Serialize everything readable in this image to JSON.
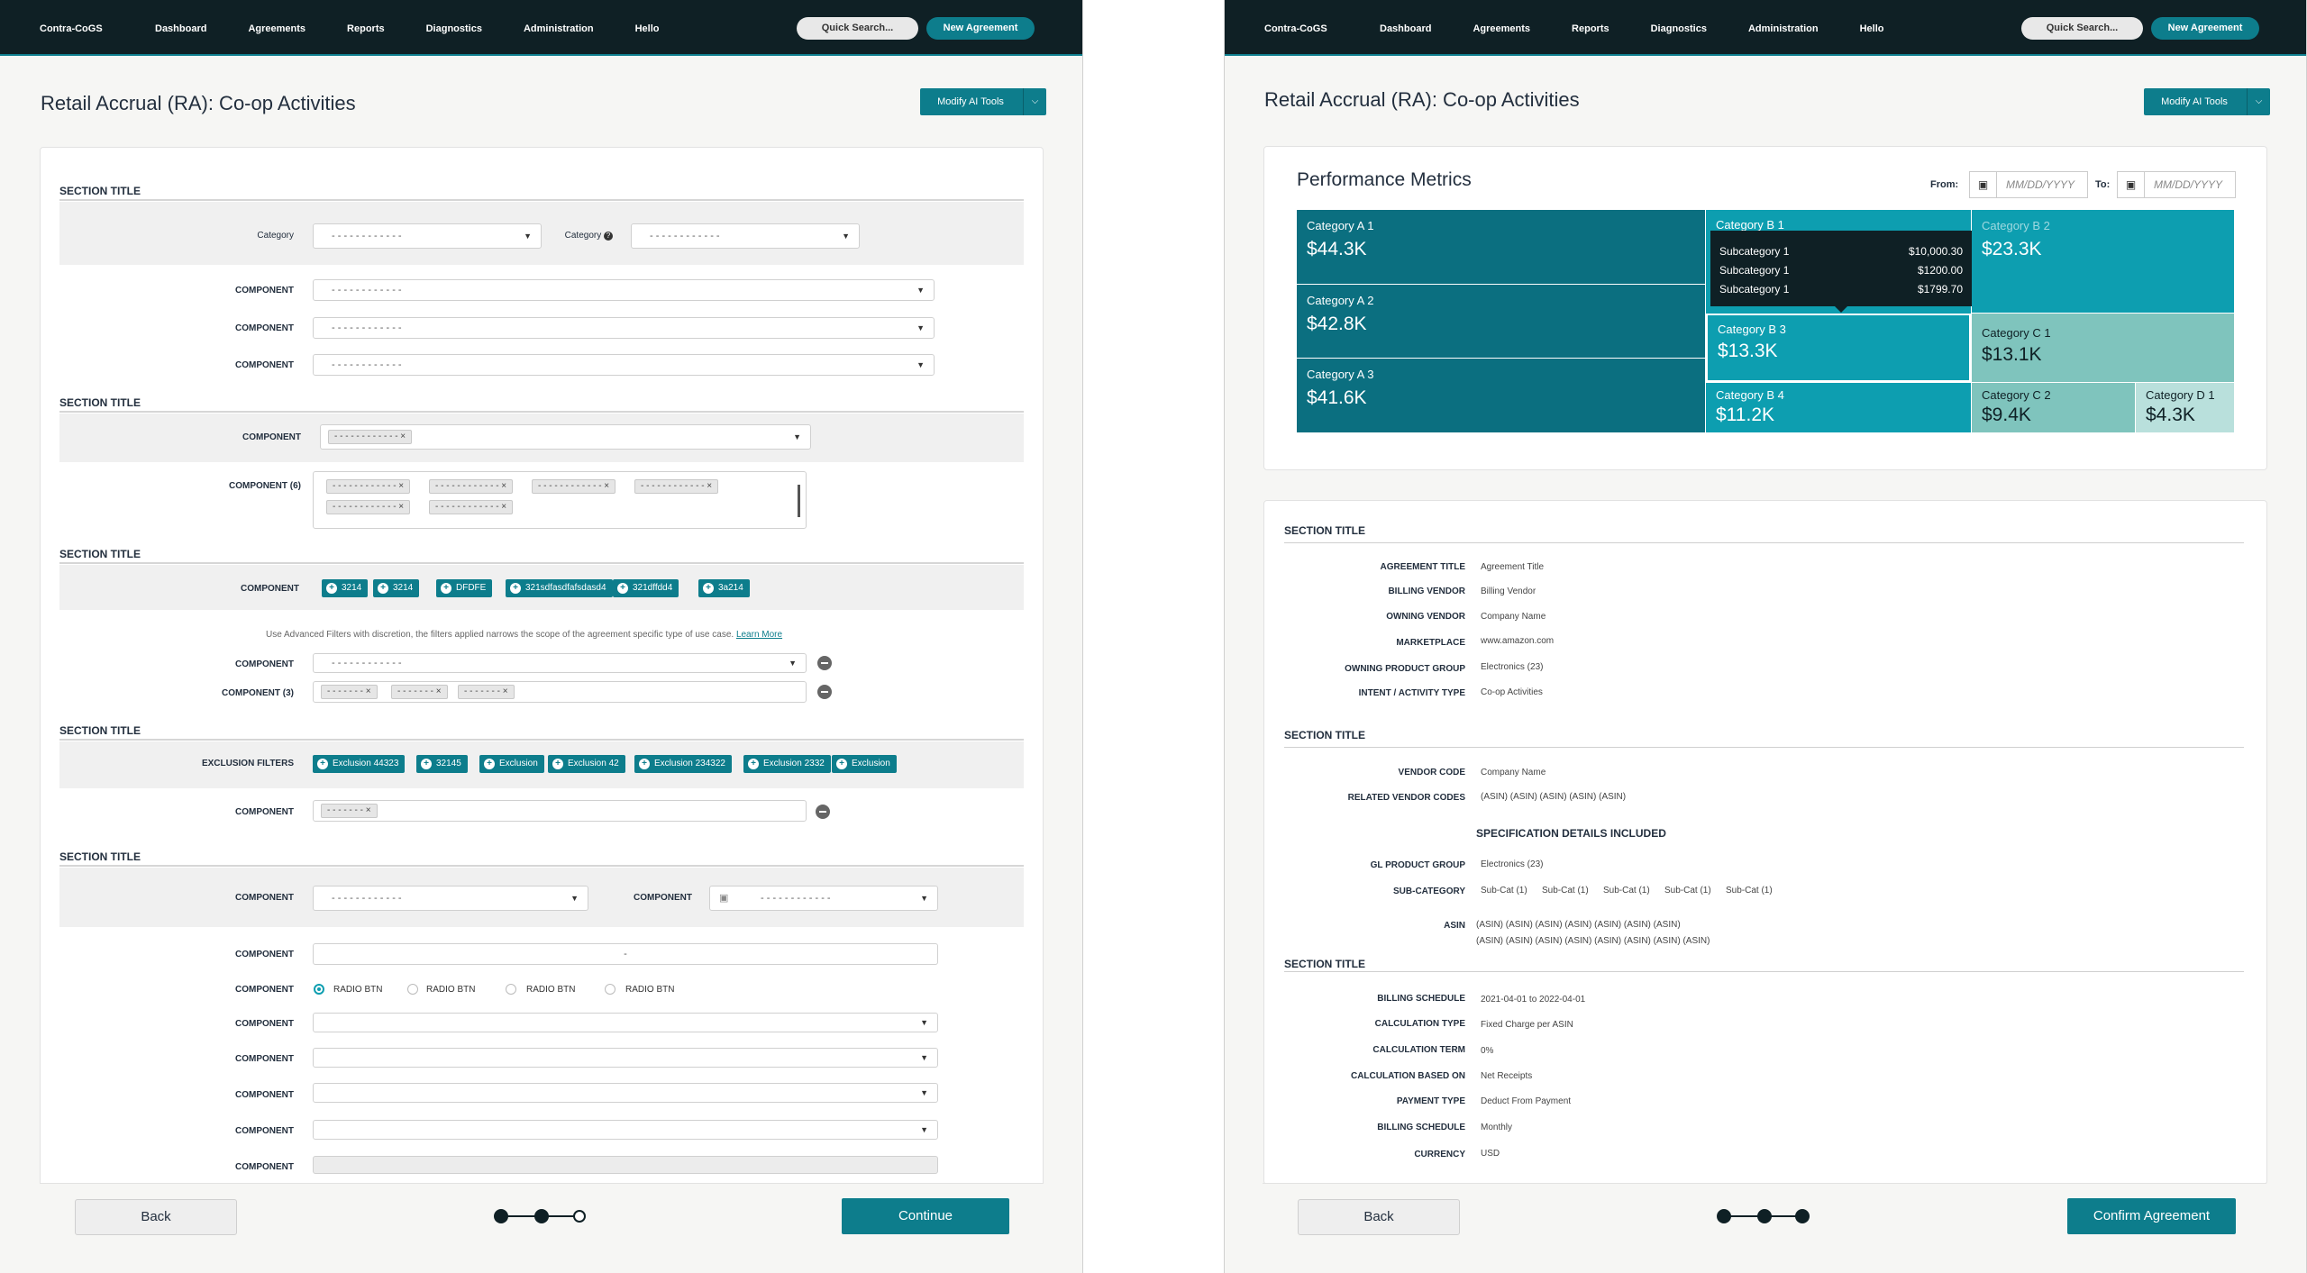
{
  "nav": {
    "brand": "Contra-CoGS",
    "links": [
      "Dashboard",
      "Agreements",
      "Reports",
      "Diagnostics",
      "Administration",
      "Hello"
    ],
    "search_placeholder": "Quick Search...",
    "new_agreement": "New Agreement"
  },
  "page_title": "Retail Accrual (RA): Co-op Activities",
  "modify_tools": "Modify AI Tools",
  "left": {
    "section_title": "SECTION TITLE",
    "category_label": "Category",
    "placeholder": "- - - - - - - - - - - -",
    "short_placeholder": "- - - - - - -",
    "comp_label": "COMPONENT",
    "comp6_label": "COMPONENT (6)",
    "comp3_label": "COMPONENT (3)",
    "excl_label": "EXCLUSION FILTERS",
    "chips_a": [
      "3214",
      "3214",
      "DFDFE",
      "321sdfasdfafsdasd4",
      "321dffdd4",
      "3a214"
    ],
    "chips_excl": [
      "Exclusion 44323",
      "32145",
      "Exclusion",
      "Exclusion 42",
      "Exclusion 234322",
      "Exclusion 2332",
      "Exclusion"
    ],
    "hint_text": "Use Advanced Filters with discretion, the filters applied narrows the scope of the agreement specific type of use case.",
    "learn_more": "Learn More",
    "radio_label": "RADIO BTN",
    "dot_value": "-"
  },
  "perf": {
    "title": "Performance Metrics",
    "from": "From:",
    "to": "To:",
    "date_placeholder": "MM/DD/YYYY"
  },
  "chart_data": {
    "type": "treemap",
    "title": "Performance Metrics",
    "nodes": [
      {
        "name": "Category A 1",
        "value": "$44.3K"
      },
      {
        "name": "Category A 2",
        "value": "$42.8K"
      },
      {
        "name": "Category A 3",
        "value": "$41.6K"
      },
      {
        "name": "Category B 1",
        "value": ""
      },
      {
        "name": "Category B 2",
        "value": "$23.3K"
      },
      {
        "name": "Category B 3",
        "value": "$13.3K"
      },
      {
        "name": "Category B 4",
        "value": "$11.2K"
      },
      {
        "name": "Category C 1",
        "value": "$13.1K"
      },
      {
        "name": "Category C 2",
        "value": "$9.4K"
      },
      {
        "name": "Category D 1",
        "value": "$4.3K"
      }
    ],
    "tooltip": [
      {
        "label": "Subcategory 1",
        "value": "$10,000.30"
      },
      {
        "label": "Subcategory 1",
        "value": "$1200.00"
      },
      {
        "label": "Subcategory 1",
        "value": "$1799.70"
      }
    ],
    "colors": {
      "A": "#0b6f80",
      "B": "#0d9eb0",
      "C": "#7fc4bd",
      "D": "#b9e0dc"
    }
  },
  "summary": {
    "section_title": "SECTION TITLE",
    "group1": [
      {
        "label": "AGREEMENT TITLE",
        "value": "Agreement Title"
      },
      {
        "label": "BILLING VENDOR",
        "value": "Billing Vendor"
      },
      {
        "label": "OWNING VENDOR",
        "value": "Company Name"
      },
      {
        "label": "MARKETPLACE",
        "value": "www.amazon.com"
      },
      {
        "label": "OWNING PRODUCT GROUP",
        "value": "Electronics (23)"
      },
      {
        "label": "INTENT / ACTIVITY TYPE",
        "value": "Co-op Activities"
      }
    ],
    "group2": [
      {
        "label": "VENDOR CODE",
        "value": "Company Name"
      },
      {
        "label": "RELATED VENDOR CODES",
        "value": "(ASIN) (ASIN) (ASIN) (ASIN) (ASIN)"
      }
    ],
    "spec_title": "SPECIFICATION DETAILS INCLUDED",
    "gl_label": "GL PRODUCT GROUP",
    "gl_value": "Electronics (23)",
    "subcat_label": "SUB-CATEGORY",
    "subcats": [
      "Sub-Cat (1)",
      "Sub-Cat (1)",
      "Sub-Cat (1)",
      "Sub-Cat (1)",
      "Sub-Cat (1)"
    ],
    "asin_label": "ASIN",
    "asin_line1": "(ASIN) (ASIN) (ASIN) (ASIN) (ASIN) (ASIN) (ASIN)",
    "asin_line2": "(ASIN) (ASIN) (ASIN) (ASIN) (ASIN) (ASIN) (ASIN) (ASIN)",
    "group3": [
      {
        "label": "BILLING SCHEDULE",
        "value": "2021-04-01 to 2022-04-01"
      },
      {
        "label": "CALCULATION TYPE",
        "value": "Fixed Charge per ASIN"
      },
      {
        "label": "CALCULATION TERM",
        "value": "0%"
      },
      {
        "label": "CALCULATION BASED ON",
        "value": "Net Receipts"
      },
      {
        "label": "PAYMENT TYPE",
        "value": "Deduct From Payment"
      },
      {
        "label": "BILLING SCHEDULE",
        "value": "Monthly"
      },
      {
        "label": "CURRENCY",
        "value": "USD"
      }
    ]
  },
  "footer": {
    "back": "Back",
    "continue": "Continue",
    "confirm": "Confirm Agreement"
  }
}
